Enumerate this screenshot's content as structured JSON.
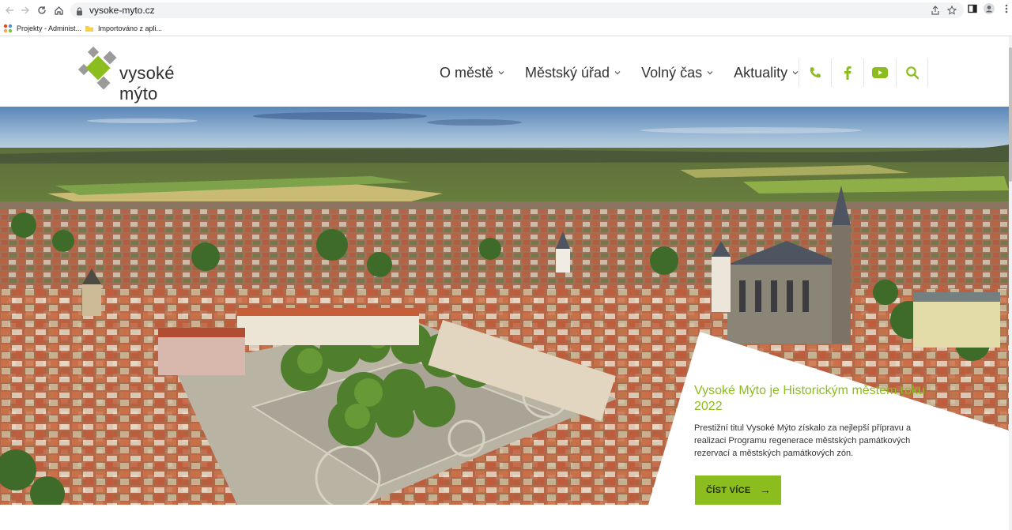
{
  "browser": {
    "url": "vysoke-myto.cz",
    "bookmarks": [
      {
        "label": "Projekty - Administ..."
      },
      {
        "label": "Importováno z apli..."
      }
    ]
  },
  "site": {
    "logo_text": "vysoké mýto",
    "nav": [
      {
        "label": "O městě"
      },
      {
        "label": "Městský úřad"
      },
      {
        "label": "Volný čas"
      },
      {
        "label": "Aktuality"
      }
    ],
    "icons": [
      "phone-icon",
      "facebook-icon",
      "youtube-icon",
      "search-icon"
    ],
    "accent_color": "#8cbd1f"
  },
  "hero": {
    "title": "Vysoké Mýto je Historickým městem roku 2022",
    "body": "Prestižní titul Vysoké Mýto získalo za nejlepší přípravu a realizaci Programu regenerace městských památkových rezervací a městských památkových zón.",
    "cta_label": "ČÍST VÍCE",
    "cta_arrow": "→"
  }
}
